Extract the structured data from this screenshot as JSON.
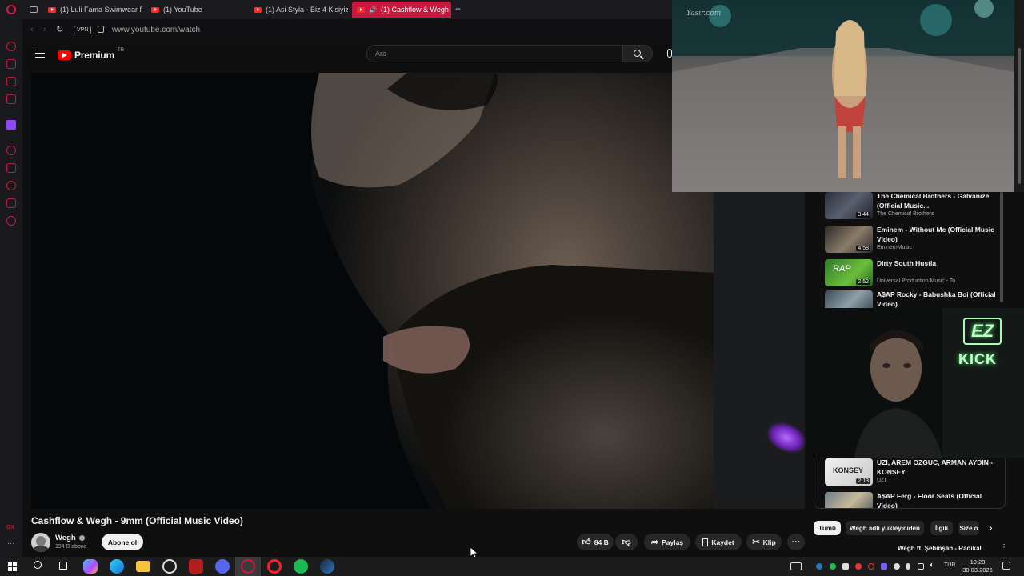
{
  "browser": {
    "tabs": [
      {
        "label": "(1) Luli Fama Swimwear Fa",
        "active": false
      },
      {
        "label": "(1) YouTube",
        "active": false
      },
      {
        "label": "(1) Asi Styla - Biz 4 Kisiyiz",
        "active": false
      },
      {
        "label": "(1) Cashflow & Wegh",
        "active": true
      }
    ],
    "new_tab_label": "+",
    "vpn_label": "VPN",
    "url": "www.youtube.com/watch"
  },
  "youtube": {
    "logo_text": "Premium",
    "region": "TR",
    "search_placeholder": "Ara"
  },
  "pip_top": {
    "watermark": "Yasir.com"
  },
  "recommendations": [
    {
      "title": "The Chemical Brothers - Galvanize (Official Music...",
      "channel": "The Chemical Brothers",
      "duration": "3:44"
    },
    {
      "title": "Eminem - Without Me (Official Music Video)",
      "channel": "EminemMusic",
      "duration": "4:58"
    },
    {
      "title": "Dirty South Hustla",
      "channel": "Universal Production Music - To...",
      "duration": "2:52",
      "thumb_text": "RAP"
    },
    {
      "title": "A$AP Rocky - Babushka Boi (Official Video)",
      "channel": "",
      "duration": ""
    },
    {
      "title": "UZI, AREM OZGUC, ARMAN AYDIN - KONSEY",
      "channel": "UZI",
      "duration": "2:13",
      "thumb_text": "KONSEY"
    },
    {
      "title": "A$AP Ferg - Floor Seats (Official Video)",
      "channel": "",
      "duration": ""
    }
  ],
  "webcam": {
    "logo_text": "EZ",
    "kick_text": "KICK"
  },
  "video": {
    "title": "Cashflow & Wegh - 9mm (Official Music Video)",
    "channel": "Wegh",
    "subscribers": "194 B abone",
    "subscribe_label": "Abone ol",
    "like_count": "84 B",
    "share_label": "Paylaş",
    "save_label": "Kaydet",
    "clip_label": "Klip"
  },
  "chips": [
    "Tümü",
    "Wegh adlı yükleyiciden",
    "İlgili",
    "Size ö"
  ],
  "next_up_title": "Wegh ft. Şehinşah - Radikal",
  "taskbar": {
    "lang": "TUR",
    "time": "19:28",
    "date": "30.03.2026"
  },
  "colors": {
    "opera_red": "#c9183d",
    "yt_red": "#ff0000",
    "background": "#0f0f0f"
  }
}
